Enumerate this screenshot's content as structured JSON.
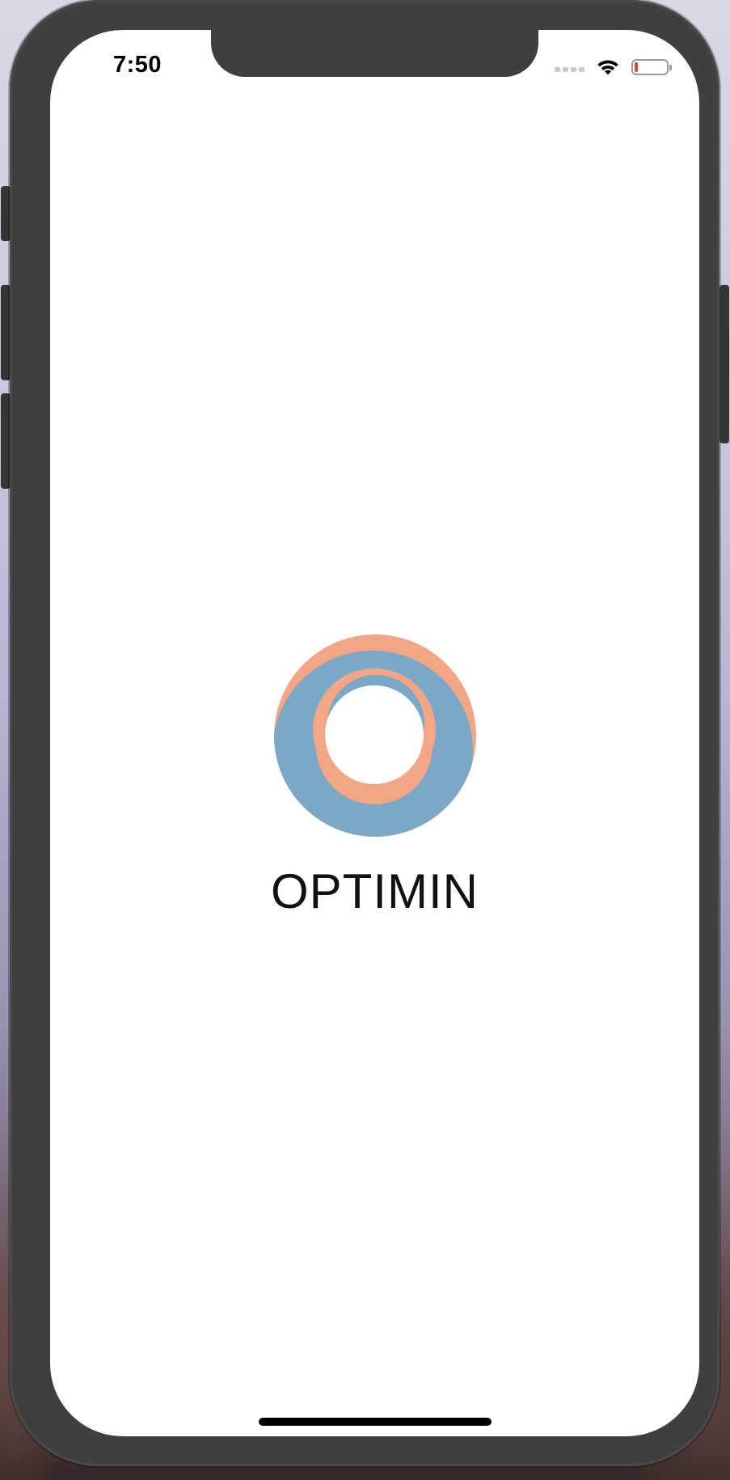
{
  "status_bar": {
    "time": "7:50",
    "battery_level": 0.1,
    "battery_color": "#e4473b"
  },
  "app": {
    "name": "OPTIMIN"
  },
  "colors": {
    "logo_orange": "#f2a685",
    "logo_blue": "#7aa8c6",
    "screen_bg": "#ffffff",
    "device_frame": "#3f3f3f"
  }
}
